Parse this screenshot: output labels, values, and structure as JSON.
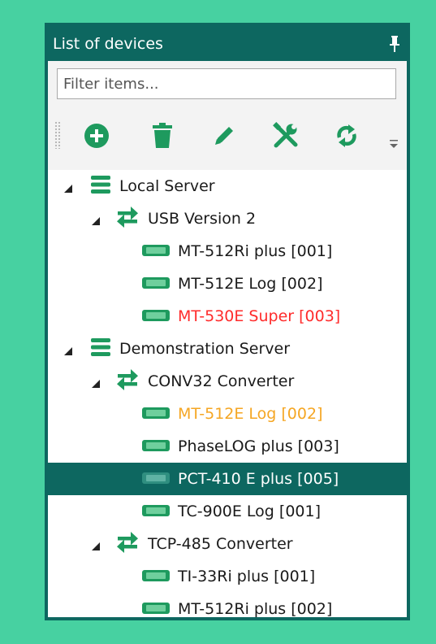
{
  "panel": {
    "title": "List of devices",
    "pin_icon": "pin-icon"
  },
  "filter": {
    "placeholder": "Filter items...",
    "value": ""
  },
  "toolbar": {
    "buttons": [
      {
        "name": "add",
        "icon": "plus-circle-icon"
      },
      {
        "name": "delete",
        "icon": "trash-icon"
      },
      {
        "name": "edit",
        "icon": "pencil-icon"
      },
      {
        "name": "settings",
        "icon": "wrench-screwdriver-icon"
      },
      {
        "name": "refresh",
        "icon": "refresh-icon"
      }
    ]
  },
  "colors": {
    "accent": "#0d6760",
    "icon_green": "#1e9a5e",
    "background": "#47d1a1",
    "warning_red": "#ff2b2b",
    "warning_orange": "#f5a623"
  },
  "tree": {
    "servers": [
      {
        "label": "Local Server",
        "converters": [
          {
            "label": "USB Version 2",
            "devices": [
              {
                "label": "MT-512Ri plus [001]",
                "status": "normal"
              },
              {
                "label": "MT-512E Log [002]",
                "status": "normal"
              },
              {
                "label": "MT-530E Super [003]",
                "status": "error"
              }
            ]
          }
        ]
      },
      {
        "label": "Demonstration Server",
        "converters": [
          {
            "label": "CONV32 Converter",
            "devices": [
              {
                "label": "MT-512E Log [002]",
                "status": "warning"
              },
              {
                "label": "PhaseLOG plus [003]",
                "status": "normal"
              },
              {
                "label": "PCT-410 E plus [005]",
                "status": "selected"
              },
              {
                "label": "TC-900E Log [001]",
                "status": "normal"
              }
            ]
          },
          {
            "label": "TCP-485 Converter",
            "devices": [
              {
                "label": "TI-33Ri plus [001]",
                "status": "normal"
              },
              {
                "label": "MT-512Ri plus [002]",
                "status": "normal"
              }
            ]
          }
        ]
      }
    ]
  }
}
